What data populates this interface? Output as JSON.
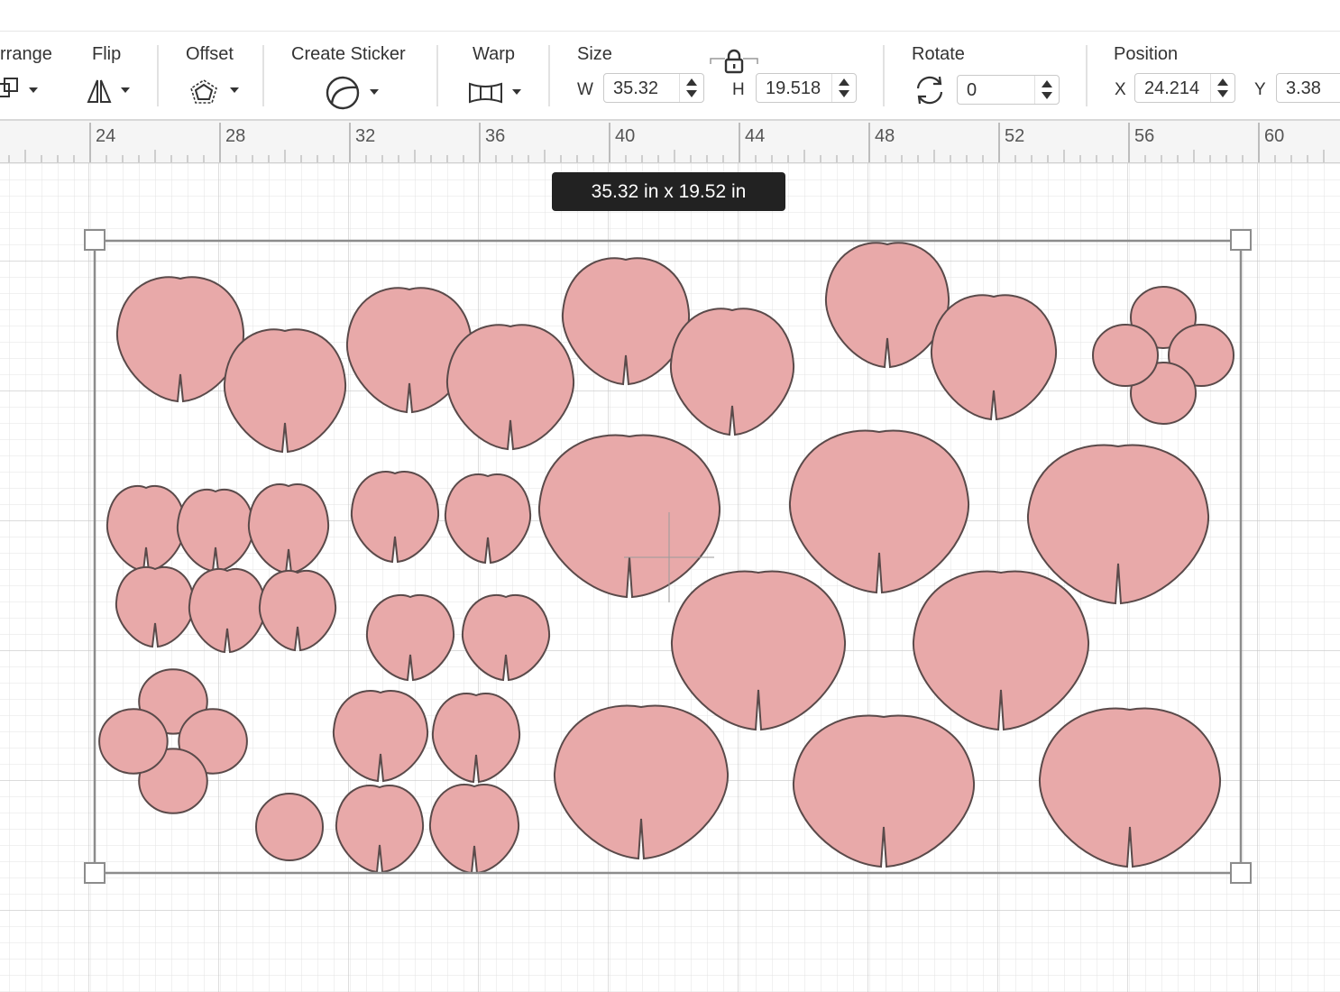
{
  "toolbar": {
    "arrange_label": "rrange",
    "flip_label": "Flip",
    "offset_label": "Offset",
    "create_sticker_label": "Create Sticker",
    "warp_label": "Warp",
    "size": {
      "label": "Size",
      "w_label": "W",
      "w_value": "35.32",
      "h_label": "H",
      "h_value": "19.518"
    },
    "rotate": {
      "label": "Rotate",
      "value": "0"
    },
    "position": {
      "label": "Position",
      "x_label": "X",
      "x_value": "24.214",
      "y_label": "Y",
      "y_value": "3.38"
    }
  },
  "ruler": {
    "ticks": [
      "24",
      "28",
      "32",
      "36",
      "40",
      "44",
      "48",
      "52",
      "56",
      "60"
    ]
  },
  "selection": {
    "dimensions_tooltip": "35.32  in x 19.52  in"
  },
  "colors": {
    "shape_fill": "#e8a9a9",
    "shape_stroke": "#5a4a4a",
    "grid_minor": "#e3e3e3",
    "grid_major": "#c9c9c9",
    "selection_box": "#8c8c8c"
  }
}
